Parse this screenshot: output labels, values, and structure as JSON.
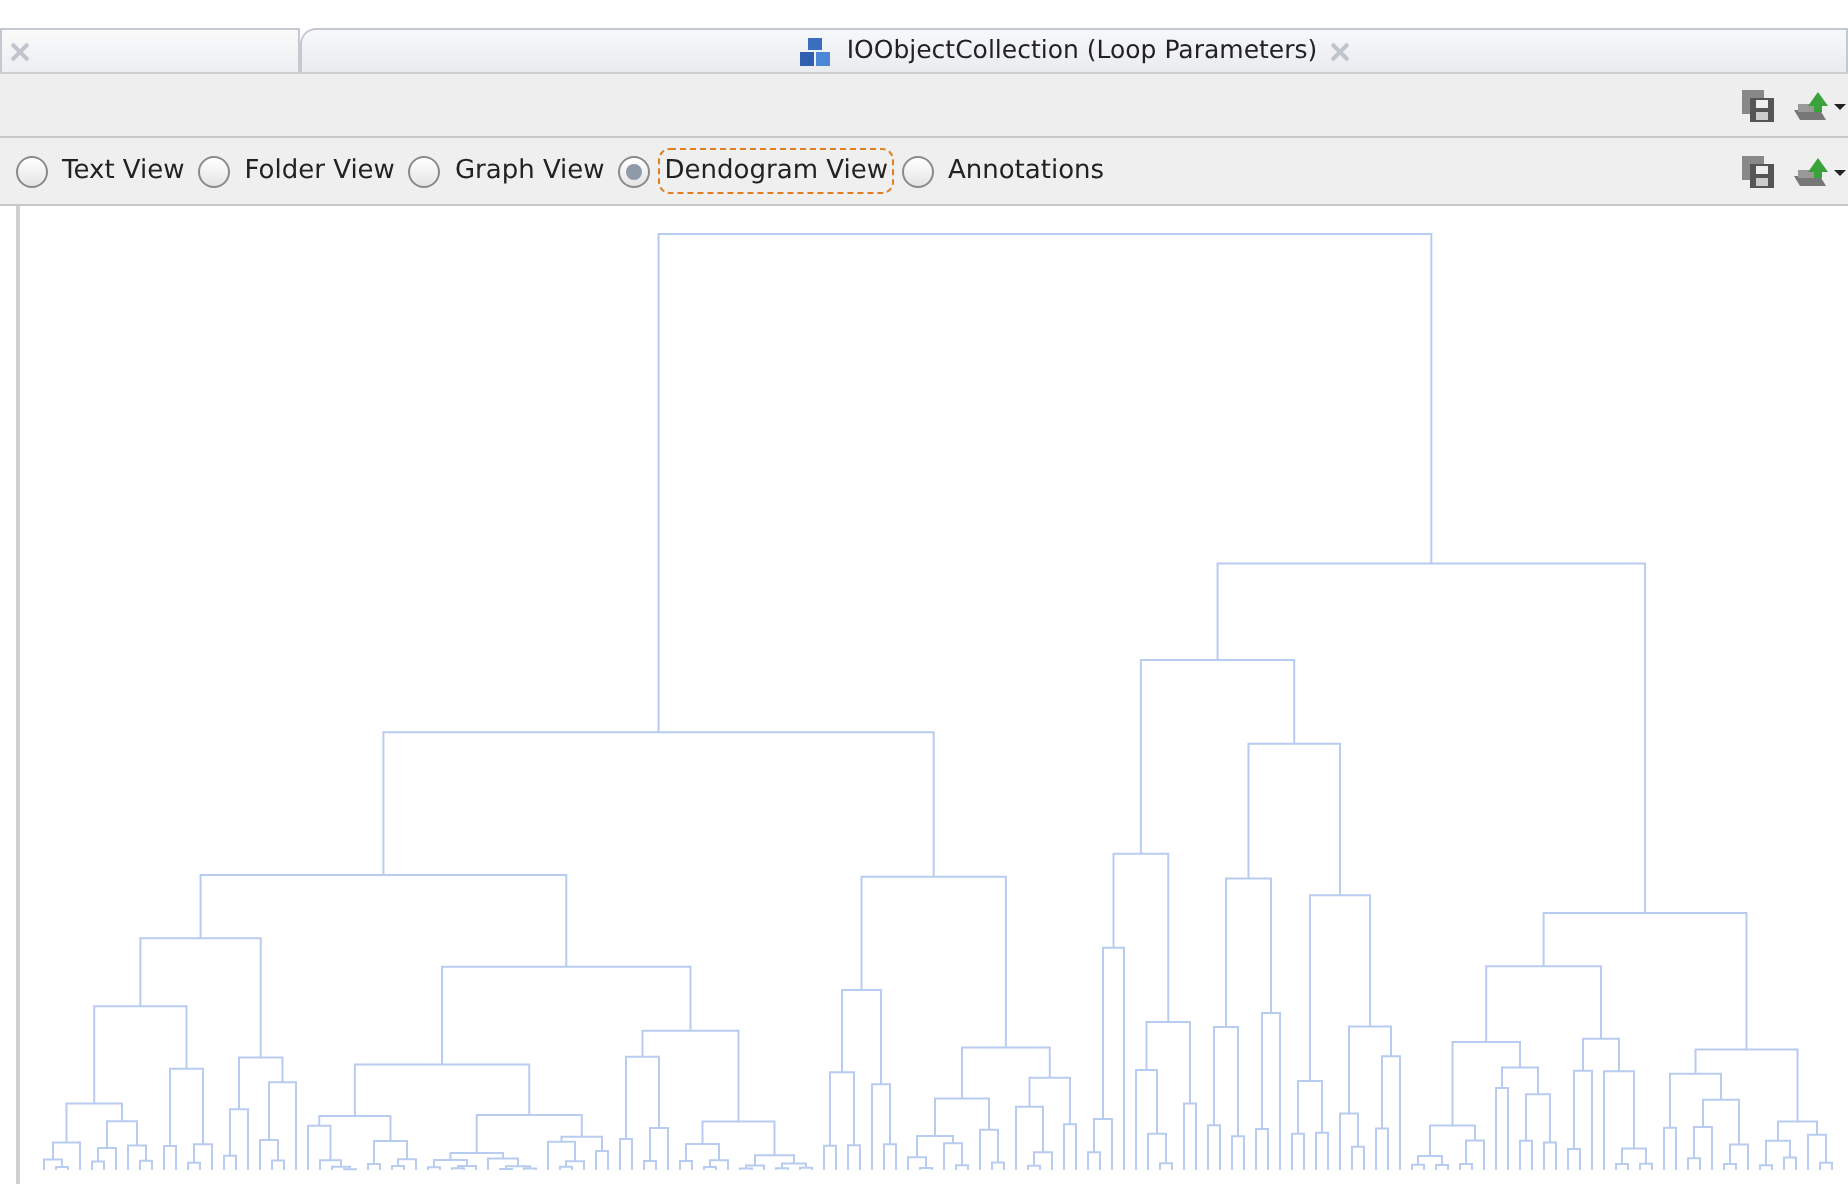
{
  "tabs": [
    {
      "selected": false
    },
    {
      "title": "IOObjectCollection (Loop Parameters)",
      "selected": true
    }
  ],
  "view_options": [
    {
      "label": "Text View",
      "selected": false,
      "focused": false
    },
    {
      "label": "Folder View",
      "selected": false,
      "focused": false
    },
    {
      "label": "Graph View",
      "selected": false,
      "focused": false
    },
    {
      "label": "Dendogram View",
      "selected": true,
      "focused": true
    },
    {
      "label": "Annotations",
      "selected": false,
      "focused": false
    }
  ]
}
